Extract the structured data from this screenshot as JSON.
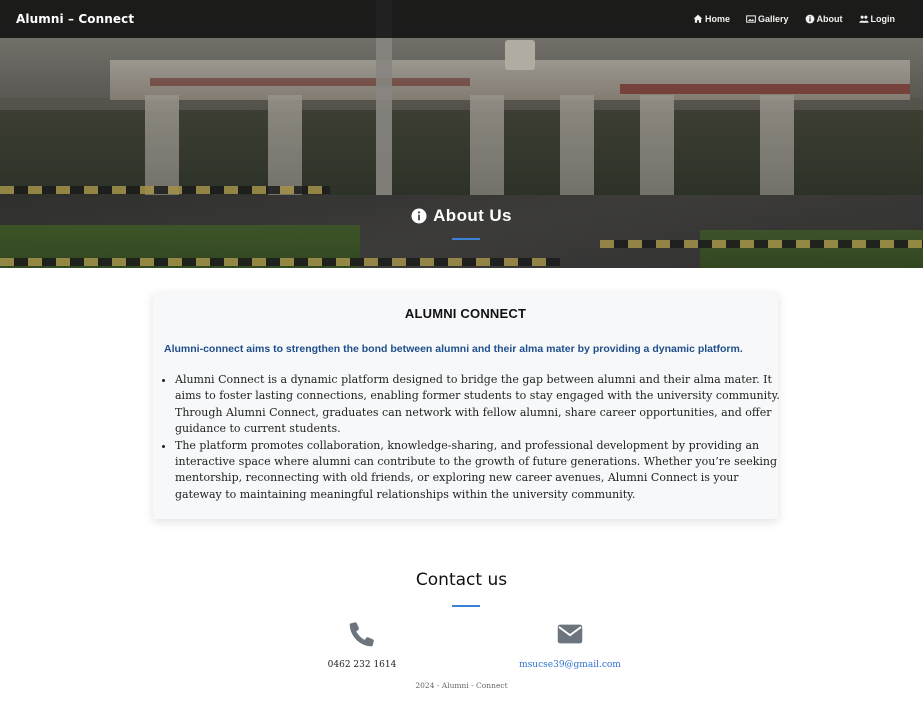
{
  "navbar": {
    "brand": "Alumni – Connect",
    "items": [
      {
        "label": "Home",
        "icon": "home-icon"
      },
      {
        "label": "Gallery",
        "icon": "image-icon"
      },
      {
        "label": "About",
        "icon": "info-icon"
      },
      {
        "label": "Login",
        "icon": "users-icon"
      }
    ]
  },
  "hero": {
    "title": "About Us",
    "icon": "info-circle-icon",
    "accent_color": "#3b82d6"
  },
  "about": {
    "title": "ALUMNI CONNECT",
    "lead": "Alumni-connect aims to strengthen the bond between alumni and their alma mater by providing a dynamic platform.",
    "points": [
      "Alumni Connect is a dynamic platform designed to bridge the gap between alumni and their alma mater. It aims to foster lasting connections, enabling former students to stay engaged with the university community. Through Alumni Connect, graduates can network with fellow alumni, share career opportunities, and offer guidance to current students.",
      "The platform promotes collaboration, knowledge-sharing, and professional development by providing an interactive space where alumni can contribute to the growth of future generations. Whether you’re seeking mentorship, reconnecting with old friends, or exploring new career avenues, Alumni Connect is your gateway to maintaining meaningful relationships within the university community."
    ]
  },
  "contact": {
    "title": "Contact us",
    "phone": {
      "icon": "phone-icon",
      "value": "0462 232 1614"
    },
    "email": {
      "icon": "envelope-icon",
      "value": "msucse39@gmail.com"
    }
  },
  "footer": {
    "text": "2024 - Alumni - Connect"
  }
}
